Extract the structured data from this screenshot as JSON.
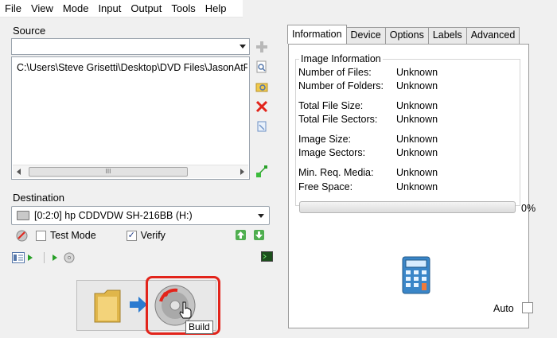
{
  "menu": [
    "File",
    "View",
    "Mode",
    "Input",
    "Output",
    "Tools",
    "Help"
  ],
  "source": {
    "label": "Source",
    "list_items": [
      "C:\\Users\\Steve Grisetti\\Desktop\\DVD Files\\JasonAtPl"
    ],
    "scroll_thumb_text": "III"
  },
  "destination": {
    "label": "Destination",
    "selected": "[0:2:0] hp CDDVDW SH-216BB (H:)",
    "test_mode_label": "Test Mode",
    "test_mode_checked": false,
    "verify_label": "Verify",
    "verify_checked": true
  },
  "build": {
    "tooltip": "Build",
    "highlight_color": "#e2241b"
  },
  "tabs": [
    "Information",
    "Device",
    "Options",
    "Labels",
    "Advanced"
  ],
  "active_tab": "Information",
  "info": {
    "group_title": "Image Information",
    "rows": [
      {
        "label": "Number of Files:",
        "value": "Unknown"
      },
      {
        "label": "Number of Folders:",
        "value": "Unknown"
      },
      {
        "label": "Total File Size:",
        "value": "Unknown"
      },
      {
        "label": "Total File Sectors:",
        "value": "Unknown"
      },
      {
        "label": "Image Size:",
        "value": "Unknown"
      },
      {
        "label": "Image Sectors:",
        "value": "Unknown"
      },
      {
        "label": "Min. Req. Media:",
        "value": "Unknown"
      },
      {
        "label": "Free Space:",
        "value": "Unknown"
      }
    ],
    "progress_percent": 0,
    "progress_text": "0%",
    "auto_label": "Auto",
    "auto_checked": false
  },
  "icons": [
    "add-icon",
    "search-file-icon",
    "browse-folder-icon",
    "delete-icon",
    "clear-list-icon",
    "calculate-icon",
    "erase-icon",
    "write-speed-up-icon",
    "write-speed-down-icon",
    "log-icon",
    "write-icon",
    "read-icon",
    "folder-icon",
    "arrow-right-icon",
    "disc-build-icon",
    "cursor-hand-icon",
    "calculator-icon"
  ],
  "colors": {
    "accent_red": "#e2241b",
    "accent_green": "#28a028",
    "accent_blue": "#2a7ad0"
  }
}
